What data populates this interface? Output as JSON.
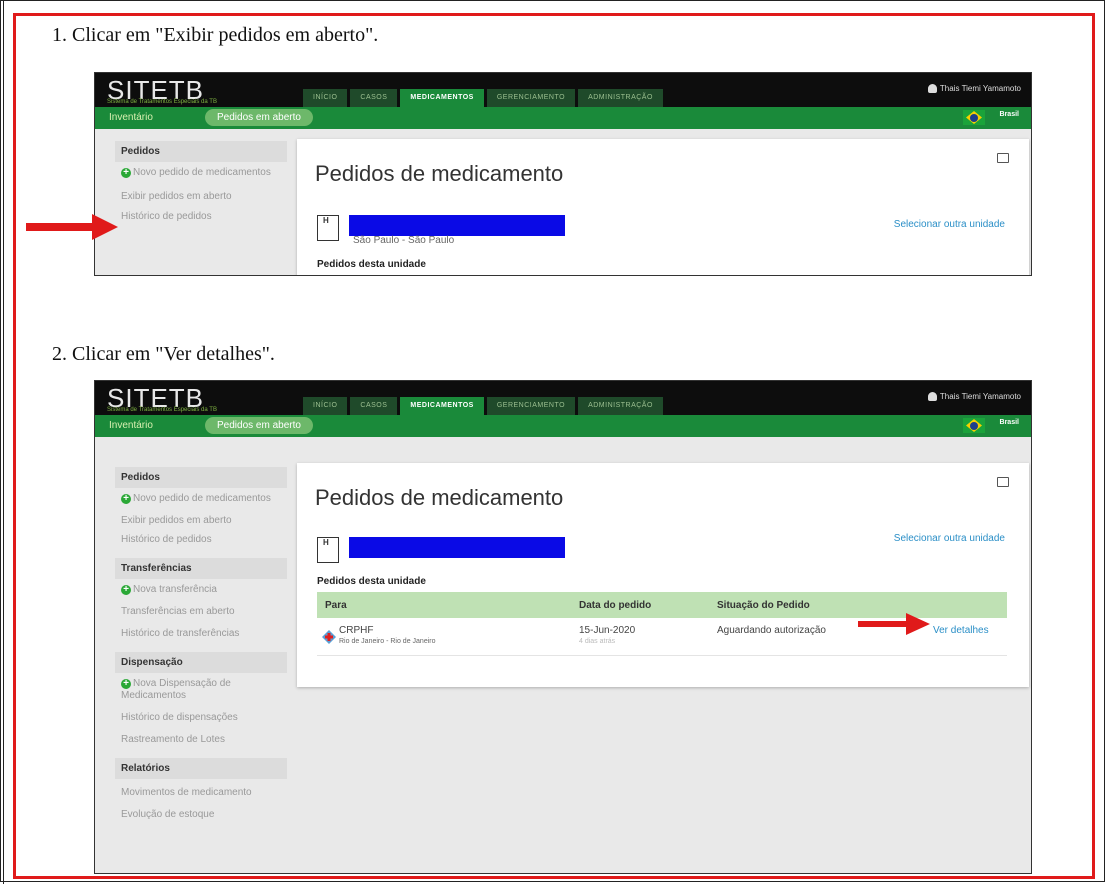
{
  "steps": {
    "one": "1. Clicar em \"Exibir pedidos em aberto\".",
    "two": "2. Clicar em \"Ver detalhes\"."
  },
  "app": {
    "logo_a": "SITE",
    "logo_b": "TB",
    "logo_sub": "Sistema de Tratamentos Especiais da TB",
    "tabs": [
      "INÍCIO",
      "CASOS",
      "MEDICAMENTOS",
      "GERENCIAMENTO",
      "ADMINISTRAÇÃO"
    ],
    "active_tab": "MEDICAMENTOS",
    "user": "Thais Tiemi Yamamoto",
    "subnav_inventory": "Inventário",
    "subnav_active": "Pedidos em aberto",
    "country": "Brasil",
    "page_title": "Pedidos de medicamento",
    "unit_location": "São Paulo - São Paulo",
    "select_other_unit": "Selecionar outra unidade",
    "orders_heading": "Pedidos desta unidade"
  },
  "sidebar": {
    "pedidos": {
      "heading": "Pedidos",
      "items": [
        "Novo pedido de medicamentos",
        "Exibir pedidos em aberto",
        "Histórico de pedidos"
      ]
    },
    "transferencias": {
      "heading": "Transferências",
      "items": [
        "Nova transferência",
        "Transferências em aberto",
        "Histórico de transferências"
      ]
    },
    "dispensacao": {
      "heading": "Dispensação",
      "items": [
        "Nova Dispensação de Medicamentos",
        "Histórico de dispensações",
        "Rastreamento de Lotes"
      ]
    },
    "relatorios": {
      "heading": "Relatórios",
      "items": [
        "Movimentos de medicamento",
        "Evolução de estoque"
      ]
    }
  },
  "table": {
    "headers": [
      "Para",
      "Data do pedido",
      "Situação do Pedido"
    ],
    "rows": [
      {
        "para": "CRPHF",
        "para_sub": "Rio de Janeiro - Rio de Janeiro",
        "data": "15-Jun-2020",
        "data_sub": "4 dias atrás",
        "situacao": "Aguardando autorização",
        "acao": "Ver detalhes"
      }
    ]
  },
  "colors": {
    "frame": "#e01a1a",
    "green": "#1a8a3a",
    "link": "#2b8fc7",
    "table_header": "#bfe1b4",
    "redacted": "#0a0ae6"
  }
}
